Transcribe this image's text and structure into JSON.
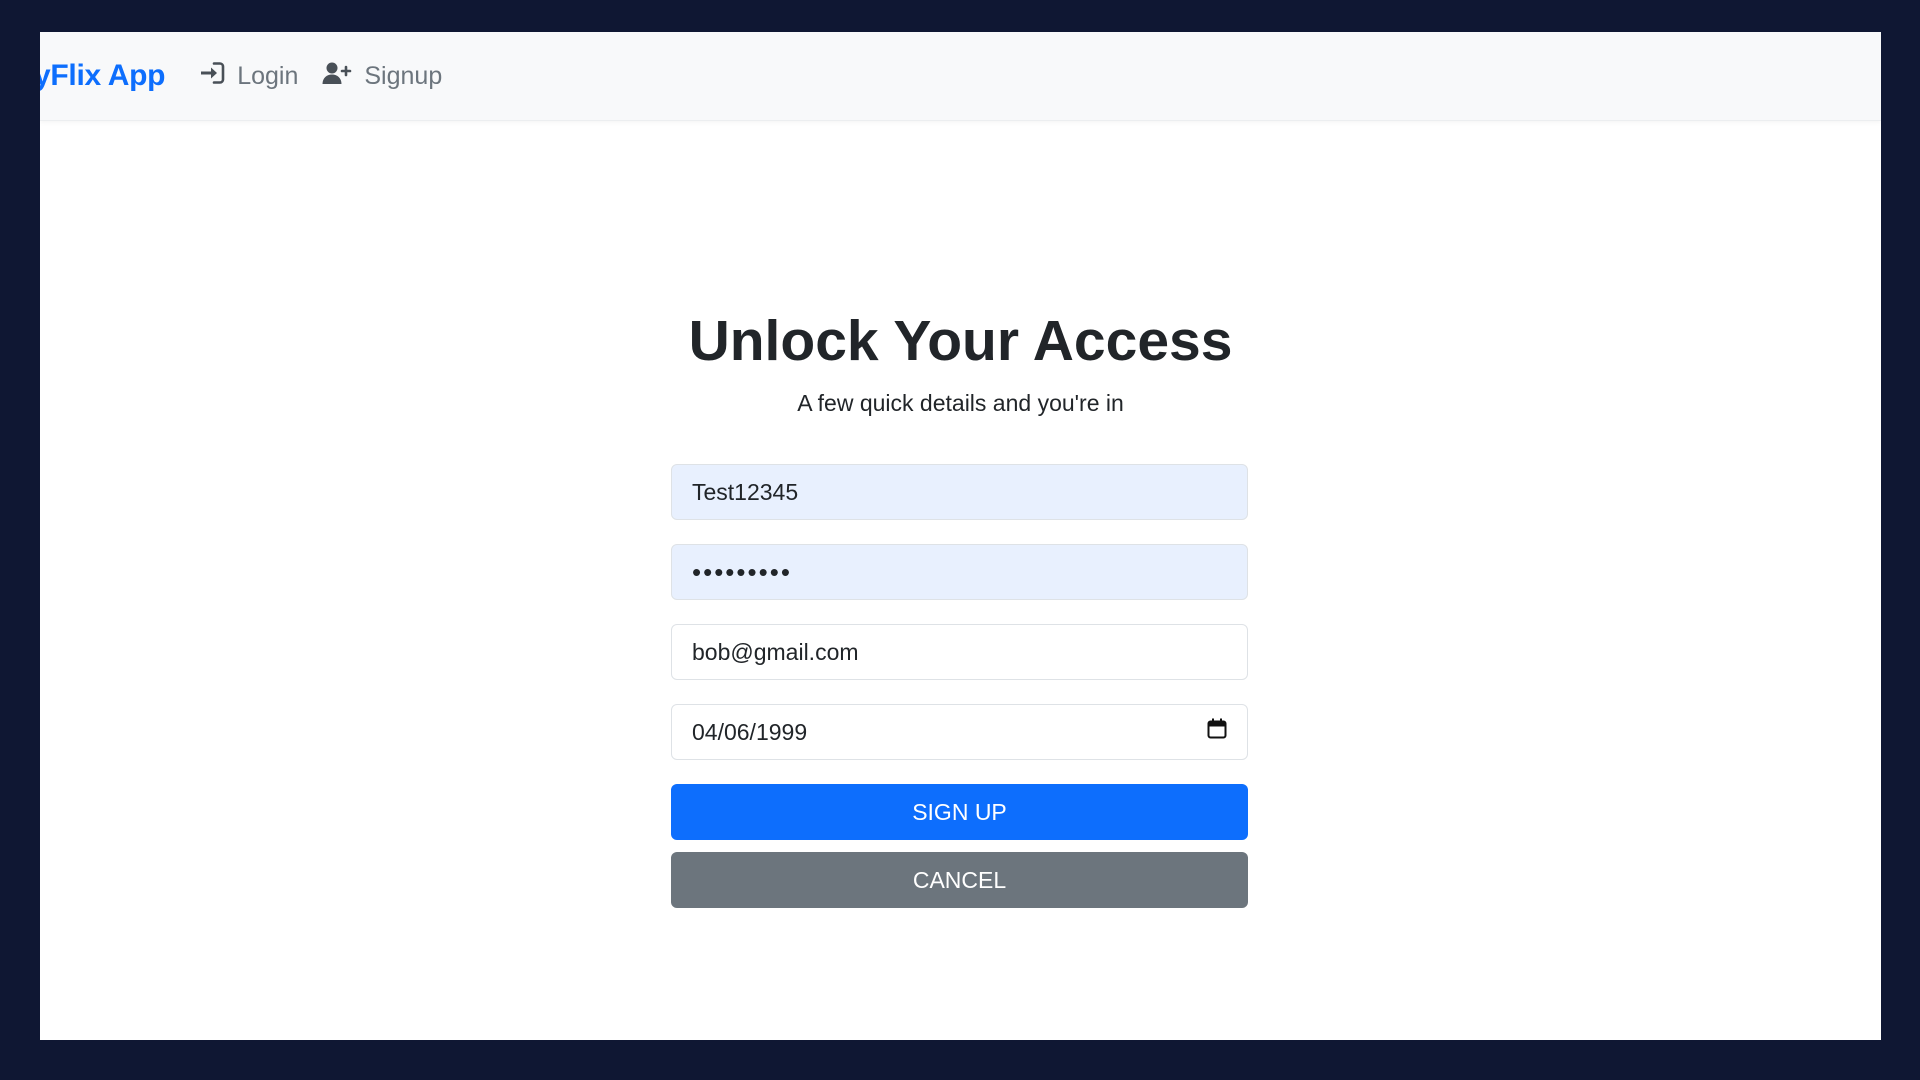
{
  "navbar": {
    "brand": "yFlix App",
    "links": [
      {
        "label": "Login",
        "icon": "sign-in-icon"
      },
      {
        "label": "Signup",
        "icon": "user-plus-icon"
      }
    ]
  },
  "main": {
    "title": "Unlock Your Access",
    "subtitle": "A few quick details and you're in"
  },
  "form": {
    "username": "Test12345",
    "password_masked": "•••••••••",
    "email": "bob@gmail.com",
    "birthday": "04/06/1999",
    "birthday_icon": "calendar-icon",
    "signup_label": "SIGN UP",
    "cancel_label": "CANCEL"
  },
  "colors": {
    "brand": "#0d6efd",
    "primary": "#0d6efd",
    "secondary": "#6c757d",
    "autofill": "#e8f0fe",
    "page_background": "#0f1733"
  }
}
